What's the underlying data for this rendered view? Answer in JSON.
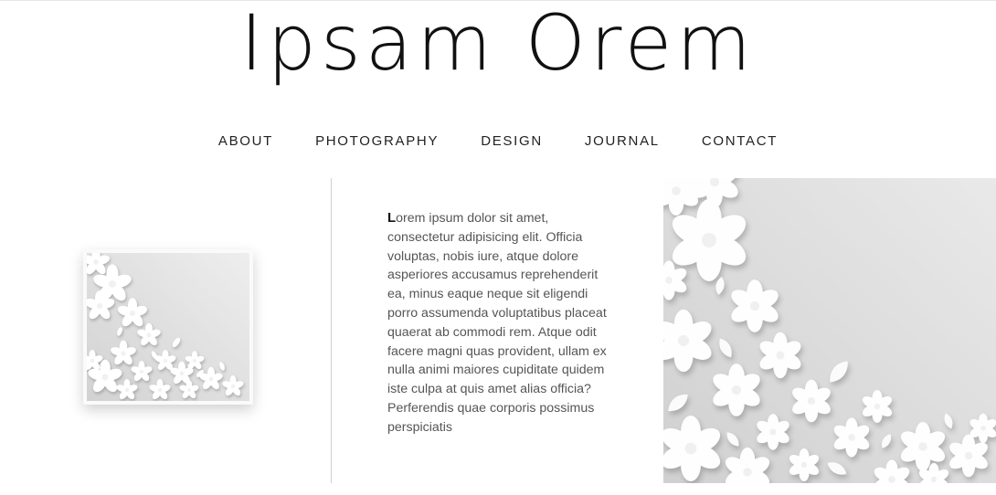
{
  "header": {
    "title": "Ipsam Orem"
  },
  "nav": {
    "items": [
      {
        "label": "ABOUT"
      },
      {
        "label": "PHOTOGRAPHY"
      },
      {
        "label": "DESIGN"
      },
      {
        "label": "JOURNAL"
      },
      {
        "label": "CONTACT"
      }
    ]
  },
  "main": {
    "drop_cap": "L",
    "paragraph": "orem ipsum dolor sit amet, consectetur adipisicing elit. Officia voluptas, nobis iure, atque dolore asperiores accusamus reprehenderit ea, minus eaque neque sit eligendi porro assumenda voluptatibus placeat quaerat ab commodi rem. Atque odit facere magni quas provident, ullam ex nulla animi maiores cupiditate quidem iste culpa at quis amet alias officia? Perferendis quae corporis possimus perspiciatis"
  },
  "colors": {
    "background": "#ffffff",
    "text": "#555555",
    "heading": "#111111",
    "image_gray": "#dcdcdc"
  }
}
